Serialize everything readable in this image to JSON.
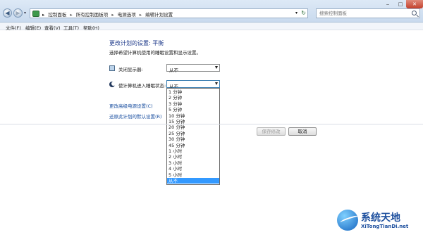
{
  "address_bar": {
    "breadcrumbs": [
      "控制面板",
      "所有控制面板项",
      "电源选项",
      "编辑计划设置"
    ],
    "separator": "▸",
    "search_placeholder": "搜索控制面板"
  },
  "menu": [
    "文件(F)",
    "编辑(E)",
    "查看(V)",
    "工具(T)",
    "帮助(H)"
  ],
  "content": {
    "title": "更改计划的设置: 平衡",
    "subtitle": "选择希望计算机使用的睡眠设置和显示设置。",
    "display_off_label": "关闭显示器:",
    "display_off_value": "从不",
    "sleep_label": "使计算机进入睡眠状态:",
    "sleep_value": "从不",
    "advanced_link": "更改高级电源设置(C)",
    "restore_link": "还原此计划的默认设置(R)"
  },
  "dropdown_options": [
    "1 分钟",
    "2 分钟",
    "3 分钟",
    "5 分钟",
    "10 分钟",
    "15 分钟",
    "20 分钟",
    "25 分钟",
    "30 分钟",
    "45 分钟",
    "1 小时",
    "2 小时",
    "3 小时",
    "4 小时",
    "5 小时",
    "从不"
  ],
  "dropdown_selected": "从不",
  "buttons": {
    "save": "保存修改",
    "cancel": "取消"
  },
  "watermark": {
    "name": "系统天地",
    "url": "XiTongTianDi.net"
  },
  "icons": [
    "back-arrow-icon",
    "forward-arrow-icon",
    "control-panel-icon",
    "refresh-icon",
    "search-icon",
    "monitor-icon",
    "sleep-moon-icon",
    "dropdown-arrow-icon"
  ],
  "colors": {
    "link": "#1a4fa0",
    "title": "#1e3a8a",
    "selection": "#3399ff"
  }
}
